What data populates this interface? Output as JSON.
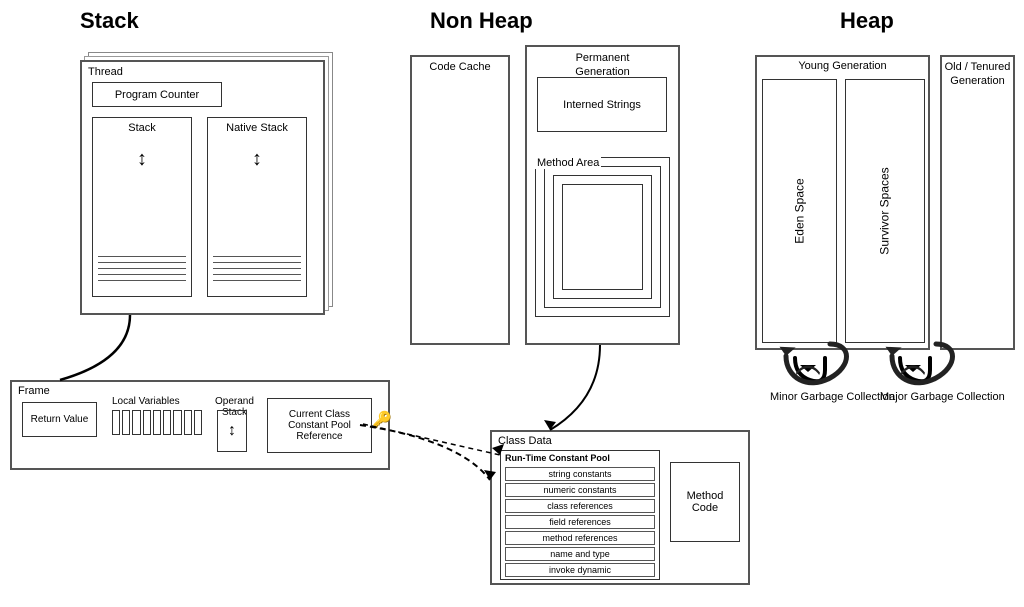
{
  "sections": {
    "stack": {
      "title": "Stack"
    },
    "nonheap": {
      "title": "Non Heap"
    },
    "heap": {
      "title": "Heap"
    }
  },
  "stack": {
    "thread_label": "Thread",
    "program_counter_label": "Program Counter",
    "stack_label": "Stack",
    "native_stack_label": "Native Stack",
    "frame_label": "Frame",
    "return_value_label": "Return Value",
    "local_variables_label": "Local Variables",
    "operand_stack_label": "Operand Stack",
    "current_class_label": "Current Class\nConstant Pool\nReference"
  },
  "nonheap": {
    "code_cache_label": "Code Cache",
    "permanent_gen_label": "Permanent\nGeneration",
    "interned_strings_label": "Interned\nStrings",
    "method_area_label": "Method Area"
  },
  "classdata": {
    "label": "Class Data",
    "runtime_pool_label": "Run-Time Constant Pool",
    "items": [
      "string constants",
      "numeric constants",
      "class references",
      "field references",
      "method references",
      "name and type",
      "invoke dynamic"
    ],
    "method_code_label": "Method\nCode"
  },
  "heap": {
    "young_gen_label": "Young Generation",
    "old_tenured_label": "Old / Tenured\nGeneration",
    "eden_label": "Eden\nSpace",
    "survivor_label": "Survivor\nSpaces",
    "minor_gc_label": "Minor\nGarbage\nCollection",
    "major_gc_label": "Major\nGarbage\nCollection"
  }
}
